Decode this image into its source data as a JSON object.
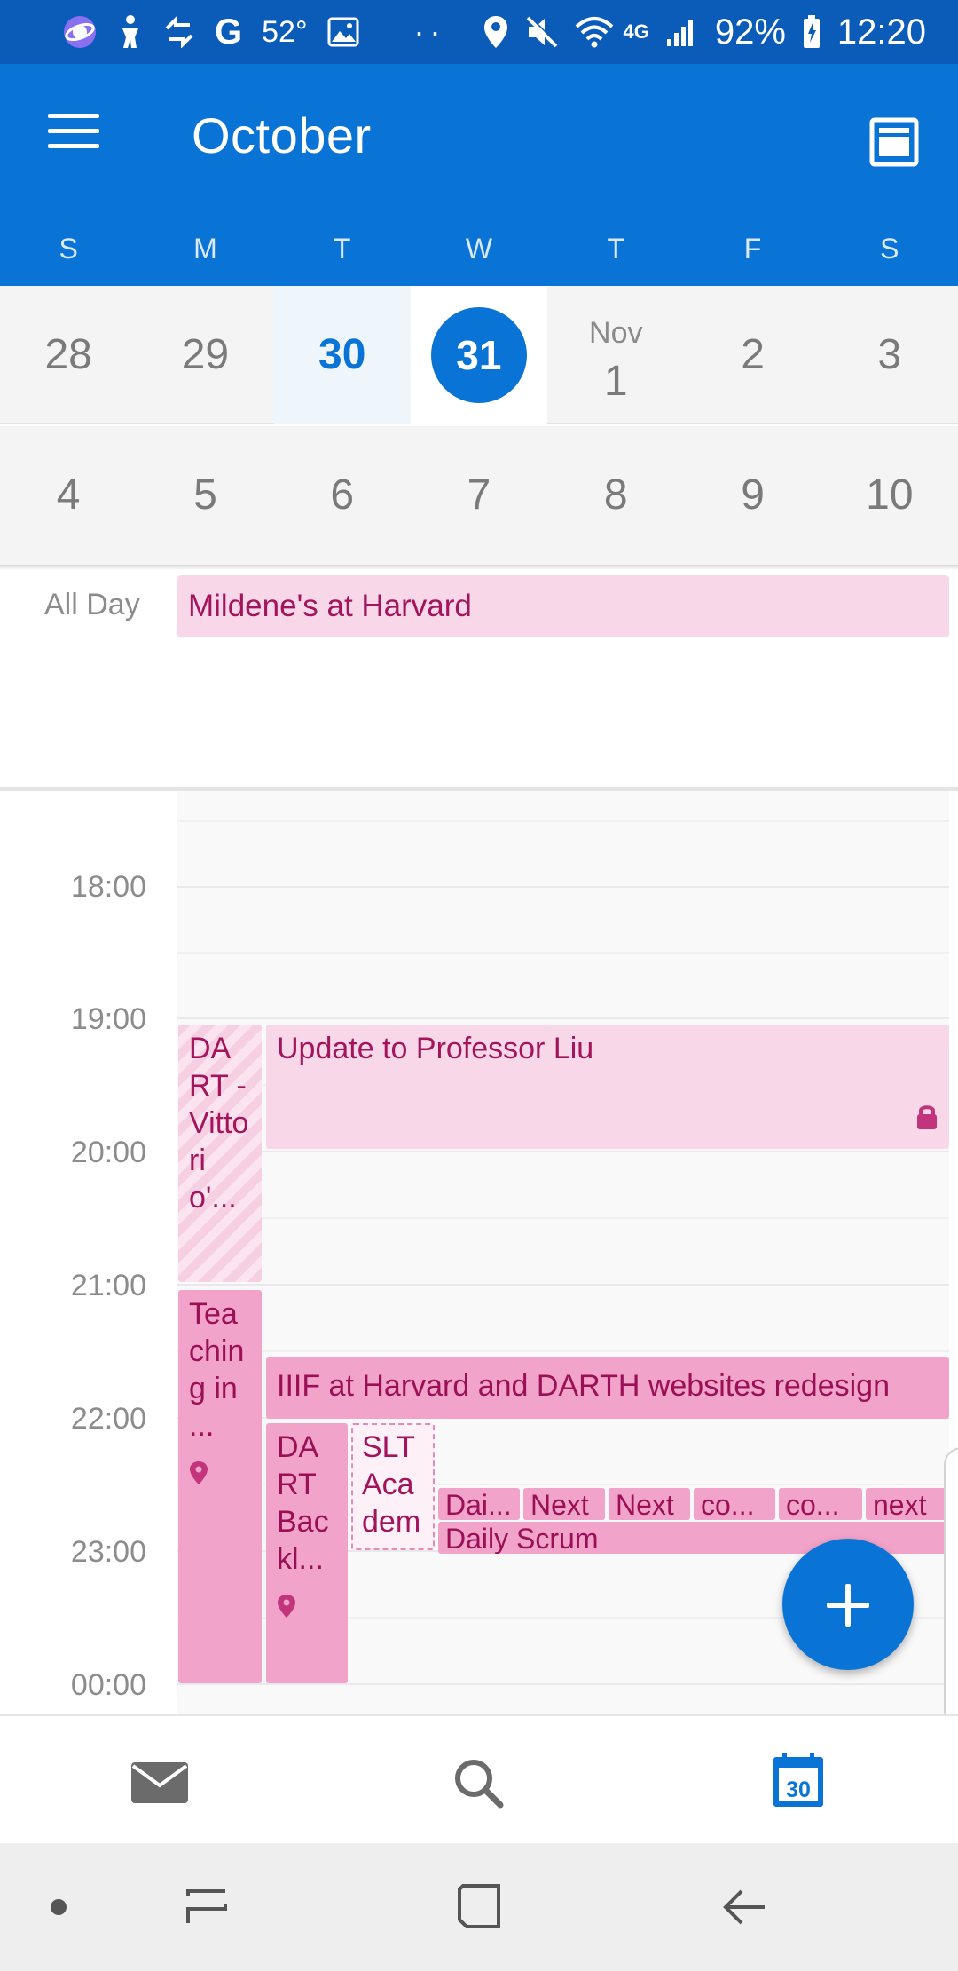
{
  "status_bar": {
    "temperature": "52°",
    "battery": "92%",
    "time": "12:20",
    "network": "4G"
  },
  "header": {
    "title": "October",
    "weekdays": [
      "S",
      "M",
      "T",
      "W",
      "T",
      "F",
      "S"
    ]
  },
  "calendar": {
    "week1": [
      {
        "label": "28"
      },
      {
        "label": "29"
      },
      {
        "label": "30",
        "state": "today"
      },
      {
        "label": "31",
        "state": "selected"
      },
      {
        "month": "Nov",
        "label": "1"
      },
      {
        "label": "2"
      },
      {
        "label": "3"
      }
    ],
    "week2": [
      "4",
      "5",
      "6",
      "7",
      "8",
      "9",
      "10"
    ]
  },
  "all_day": {
    "label": "All Day",
    "event": "Mildene's at Harvard"
  },
  "timeline": {
    "hours": [
      "18:00",
      "19:00",
      "20:00",
      "21:00",
      "22:00",
      "23:00",
      "00:00"
    ],
    "events": {
      "dart_vittorio": "DART - Vittorio'...",
      "update_liu": "Update to Professor Liu",
      "teaching": "Teaching in ...",
      "iiif": "IIIF at Harvard and DARTH websites redesign",
      "dart_backlog": "DART Backl...",
      "slt": "SLT Academ-",
      "mini": [
        "Dai...",
        "Next",
        "Next",
        "co...",
        "co...",
        "next"
      ],
      "daily_scrum": "Daily Scrum"
    }
  },
  "bottom_tabs": {
    "calendar_badge": "30"
  },
  "colors": {
    "brand": "#0a74d6",
    "status_bar": "#0a5cb8",
    "event_text": "#a3145d",
    "event_light": "#f7d7e8",
    "event_strong": "#f2a3ca"
  }
}
